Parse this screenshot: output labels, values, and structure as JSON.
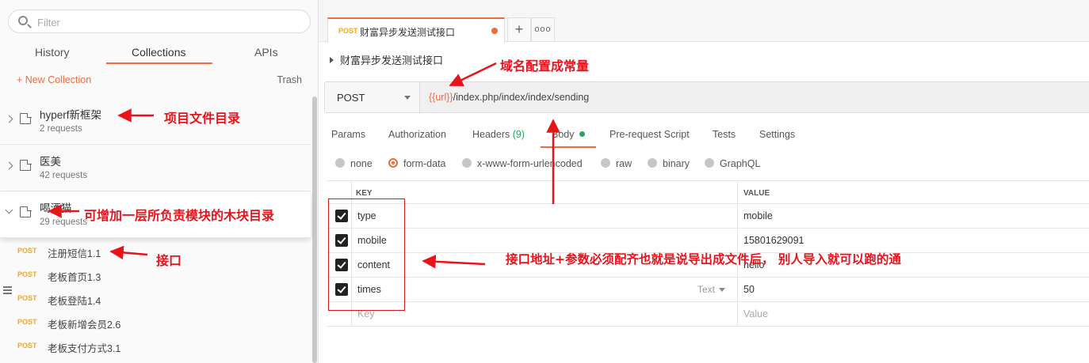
{
  "sidebar": {
    "filter_placeholder": "Filter",
    "tabs": [
      "History",
      "Collections",
      "APIs"
    ],
    "new_collection": "+ New Collection",
    "trash": "Trash",
    "collections": [
      {
        "name": "hyperf新框架",
        "count": "2 requests"
      },
      {
        "name": "医美",
        "count": "42 requests"
      },
      {
        "name": "喝酒猫",
        "count": "29 requests"
      }
    ],
    "requests": [
      {
        "method": "POST",
        "name": "注册短信1.1"
      },
      {
        "method": "POST",
        "name": "老板首页1.3"
      },
      {
        "method": "POST",
        "name": "老板登陆1.4"
      },
      {
        "method": "POST",
        "name": "老板新增会员2.6"
      },
      {
        "method": "POST",
        "name": "老板支付方式3.1"
      }
    ]
  },
  "main": {
    "tab": {
      "method": "POST",
      "title": "财富异步发送测试接口"
    },
    "plus": "+",
    "more": "ooo",
    "breadcrumb": "财富异步发送测试接口",
    "method": "POST",
    "url_var": "{{url}}",
    "url_path": "/index.php/index/index/sending",
    "subtabs": {
      "params": "Params",
      "authorization": "Authorization",
      "headers": "Headers",
      "headers_count": "(9)",
      "body": "Body",
      "prerequest": "Pre-request Script",
      "tests": "Tests",
      "settings": "Settings"
    },
    "body_modes": [
      "none",
      "form-data",
      "x-www-form-urlencoded",
      "raw",
      "binary",
      "GraphQL"
    ],
    "table": {
      "key_header": "KEY",
      "value_header": "VALUE",
      "rows": [
        {
          "key": "type",
          "value": "mobile"
        },
        {
          "key": "mobile",
          "value": "15801629091"
        },
        {
          "key": "content",
          "value": "hello"
        },
        {
          "key": "times",
          "value": "50",
          "type_label": "Text"
        }
      ],
      "key_placeholder": "Key",
      "value_placeholder": "Value"
    }
  },
  "annotations": {
    "project_dir": "项目文件目录",
    "domain_const": "域名配置成常量",
    "module_dir": "可增加一层所负责模块的木块目录",
    "api": "接口",
    "note": "接口地址+参数必须配齐也就是说导出成文件后， 别人导入就可以跑的通"
  },
  "colors": {
    "accent": "#f26b3a",
    "post": "#f5a623",
    "annotation": "#e8141a",
    "green": "#26a65b"
  }
}
